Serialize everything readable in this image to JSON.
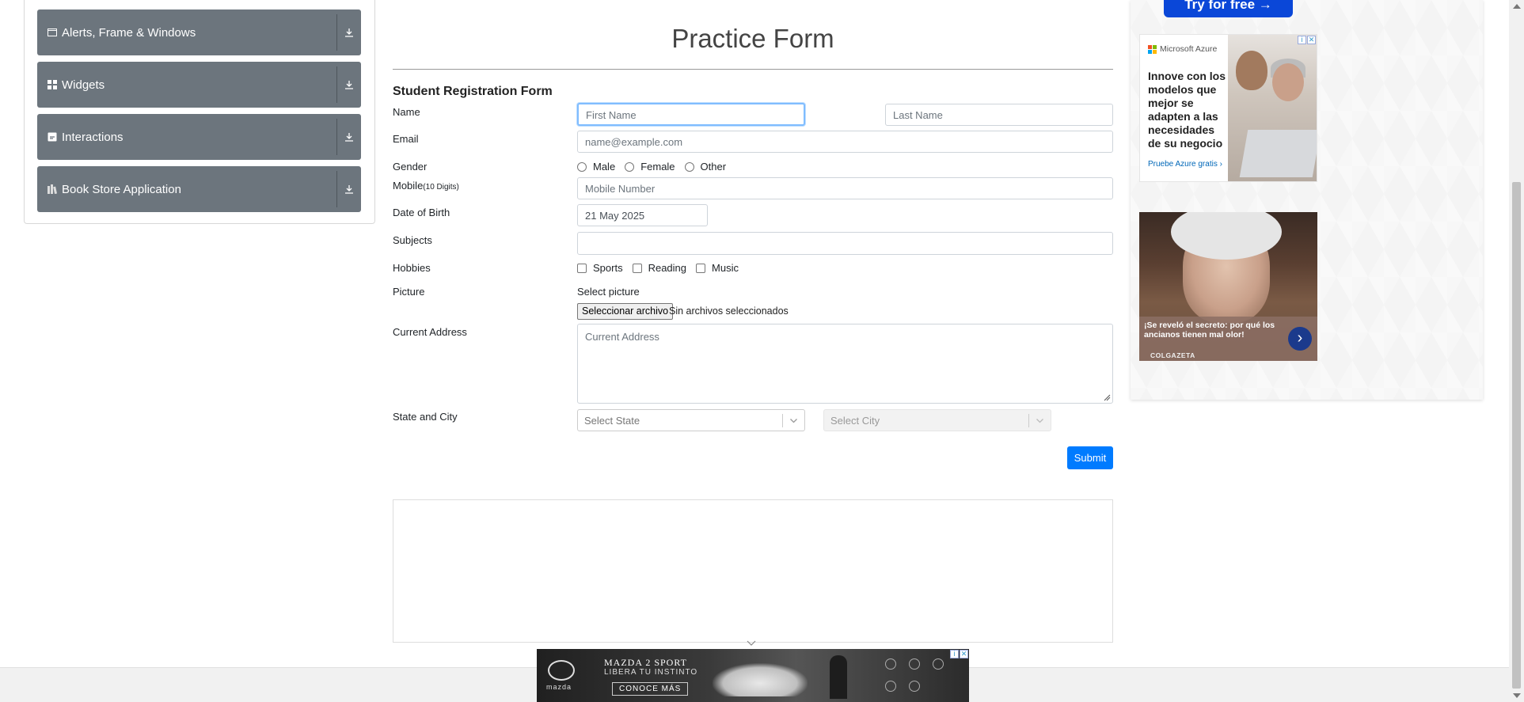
{
  "sidebar": {
    "groups": [
      {
        "label": "Alerts, Frame & Windows",
        "icon": "window-icon"
      },
      {
        "label": "Widgets",
        "icon": "grid-icon"
      },
      {
        "label": "Interactions",
        "icon": "interaction-icon"
      },
      {
        "label": "Book Store Application",
        "icon": "book-icon"
      }
    ]
  },
  "form": {
    "title": "Practice Form",
    "subtitle": "Student Registration Form",
    "labels": {
      "name": "Name",
      "email": "Email",
      "gender": "Gender",
      "mobile": "Mobile",
      "mobile_hint": "(10 Digits)",
      "dob": "Date of Birth",
      "subjects": "Subjects",
      "hobbies": "Hobbies",
      "picture": "Picture",
      "address": "Current Address",
      "state_city": "State and City"
    },
    "placeholders": {
      "first_name": "First Name",
      "last_name": "Last Name",
      "email": "name@example.com",
      "mobile": "Mobile Number",
      "address": "Current Address"
    },
    "dob_value": "21 May 2025",
    "gender_options": [
      "Male",
      "Female",
      "Other"
    ],
    "hobby_options": [
      "Sports",
      "Reading",
      "Music"
    ],
    "picture": {
      "select_label": "Select picture",
      "button": "Seleccionar archivo",
      "no_file": "Sin archivos seleccionados"
    },
    "state_placeholder": "Select State",
    "city_placeholder": "Select City",
    "submit": "Submit"
  },
  "ads": {
    "try_free": "Try for free →",
    "azure": {
      "brand": "Microsoft Azure",
      "headline": "Innove con los modelos que mejor se adapten a las necesidades de su negocio",
      "cta": "Pruebe Azure gratis ›"
    },
    "colgazeta": {
      "text": "¡Se reveló el secreto: por qué los ancianos tienen mal olor!",
      "brand": "COLGAZETA"
    },
    "mazda": {
      "line1": "MAZDA 2 SPORT",
      "line2": "LIBERA TU INSTINTO",
      "cta": "CONOCE MÁS",
      "logo_word": "mazda"
    }
  },
  "colors": {
    "sidebar_group": "#6c757d",
    "primary": "#007bff",
    "focus_border": "#80bdff"
  }
}
